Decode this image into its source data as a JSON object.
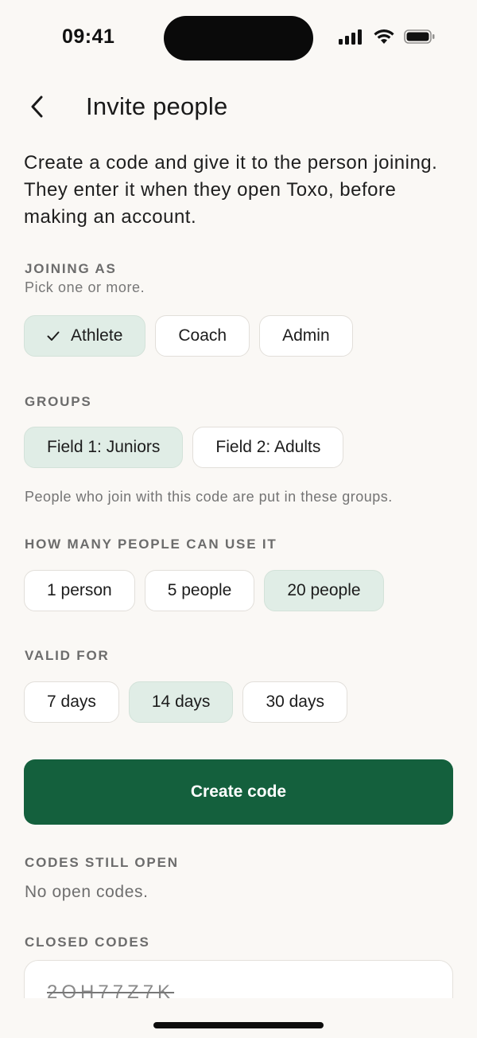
{
  "status": {
    "time": "09:41"
  },
  "header": {
    "title": "Invite people"
  },
  "intro": "Create a code and give it to the person joining. They enter it when they open Toxo, before making an account.",
  "joining": {
    "label": "JOINING AS",
    "hint": "Pick one or more.",
    "options": [
      {
        "label": "Athlete",
        "selected": true
      },
      {
        "label": "Coach",
        "selected": false
      },
      {
        "label": "Admin",
        "selected": false
      }
    ]
  },
  "groups": {
    "label": "GROUPS",
    "options": [
      {
        "label": "Field 1: Juniors",
        "selected": true
      },
      {
        "label": "Field 2: Adults",
        "selected": false
      }
    ],
    "note": "People who join with this code are put in these groups."
  },
  "uses": {
    "label": "HOW MANY PEOPLE CAN USE IT",
    "options": [
      {
        "label": "1 person",
        "selected": false
      },
      {
        "label": "5 people",
        "selected": false
      },
      {
        "label": "20 people",
        "selected": true
      }
    ]
  },
  "valid": {
    "label": "VALID FOR",
    "options": [
      {
        "label": "7 days",
        "selected": false
      },
      {
        "label": "14 days",
        "selected": true
      },
      {
        "label": "30 days",
        "selected": false
      }
    ]
  },
  "create_button": "Create code",
  "open_codes": {
    "label": "CODES STILL OPEN",
    "empty": "No open codes."
  },
  "closed_codes": {
    "label": "CLOSED CODES",
    "items": [
      {
        "code": "2QH77Z7K"
      }
    ]
  },
  "colors": {
    "accent": "#14603d",
    "selected_chip": "#e0ede6",
    "background": "#faf8f5"
  }
}
